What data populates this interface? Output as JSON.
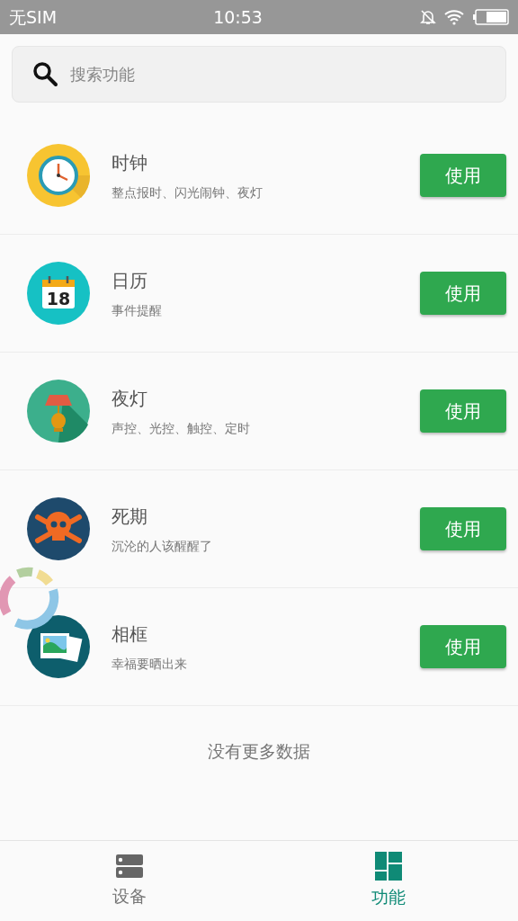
{
  "status_bar": {
    "carrier": "无SIM",
    "time": "10:53"
  },
  "search": {
    "placeholder": "搜索功能"
  },
  "features": [
    {
      "kind": "clock",
      "title": "时钟",
      "subtitle": "整点报时、闪光闹钟、夜灯",
      "button": "使用"
    },
    {
      "kind": "calendar",
      "icon_text": "18",
      "title": "日历",
      "subtitle": "事件提醒",
      "button": "使用"
    },
    {
      "kind": "lamp",
      "title": "夜灯",
      "subtitle": "声控、光控、触控、定时",
      "button": "使用"
    },
    {
      "kind": "skull",
      "title": "死期",
      "subtitle": "沉沦的人该醒醒了",
      "button": "使用"
    },
    {
      "kind": "photo",
      "title": "相框",
      "subtitle": "幸福要晒出来",
      "button": "使用"
    }
  ],
  "footer_note": "没有更多数据",
  "tabs": [
    {
      "kind": "devices",
      "label": "设备",
      "selected": false
    },
    {
      "kind": "features",
      "label": "功能",
      "selected": true
    }
  ]
}
